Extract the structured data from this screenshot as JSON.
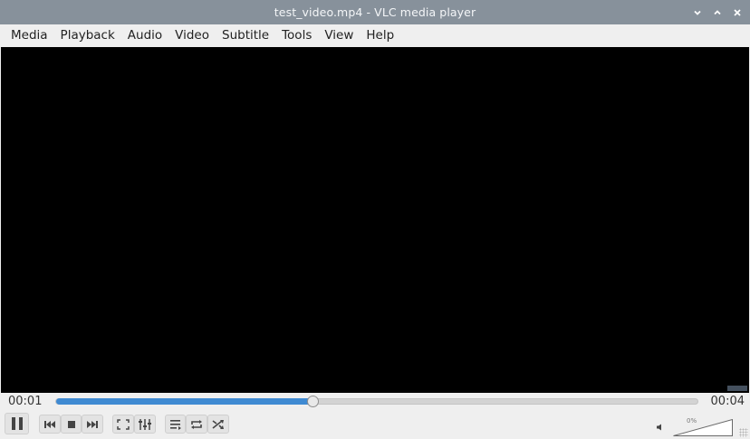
{
  "window": {
    "title": "test_video.mp4 - VLC media player",
    "controls": [
      "minimize-icon",
      "maximize-icon",
      "close-icon"
    ]
  },
  "menu": [
    "Media",
    "Playback",
    "Audio",
    "Video",
    "Subtitle",
    "Tools",
    "View",
    "Help"
  ],
  "playback": {
    "elapsed": "00:01",
    "total": "00:04",
    "progress_fraction": 0.4
  },
  "toolbar": {
    "buttons": [
      {
        "name": "pause-icon"
      },
      {
        "name": "previous-icon"
      },
      {
        "name": "stop-icon"
      },
      {
        "name": "next-icon"
      },
      {
        "name": "fullscreen-icon"
      },
      {
        "name": "extended-settings-icon"
      },
      {
        "name": "playlist-icon"
      },
      {
        "name": "loop-icon"
      },
      {
        "name": "shuffle-icon"
      }
    ]
  },
  "volume": {
    "label": "0%",
    "level_fraction": 0
  },
  "colors": {
    "titlebar": "#87919b",
    "seek_fill": "#3f8ad2",
    "video_bg": "#000000",
    "chrome_bg": "#efefef"
  }
}
